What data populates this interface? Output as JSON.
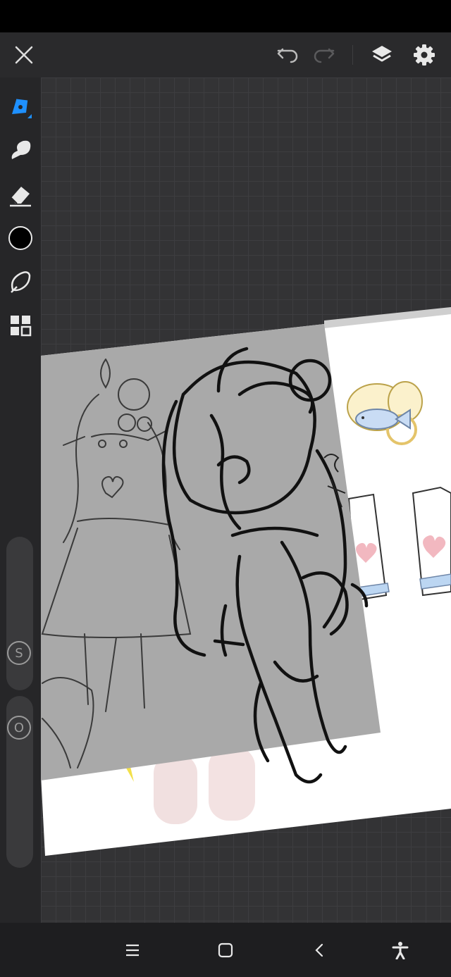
{
  "app": {
    "accent_color": "#1e90ff",
    "background_color": "#2e2e30"
  },
  "topbar": {
    "icons": [
      "close-icon",
      "undo-icon",
      "redo-icon",
      "layers-icon",
      "settings-icon"
    ]
  },
  "toolbar": {
    "tools": [
      "pen-icon",
      "smudge-icon",
      "eraser-icon",
      "color-swatch",
      "lasso-icon",
      "gallery-icon"
    ],
    "current_color": "#000000",
    "size_slider_label": "S",
    "opacity_slider_label": "O"
  },
  "navbar": {
    "icons": [
      "recents-icon",
      "home-icon",
      "back-icon",
      "accessibility-icon"
    ]
  }
}
